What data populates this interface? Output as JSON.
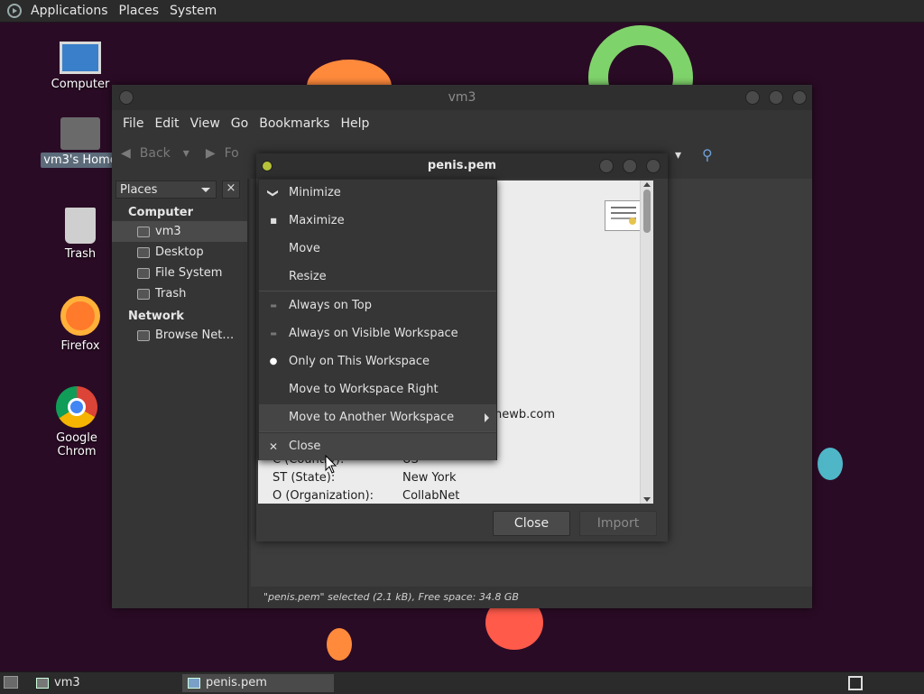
{
  "top_panel": {
    "menus": [
      "Applications",
      "Places",
      "System"
    ]
  },
  "desktop": {
    "icons": [
      {
        "label": "Computer"
      },
      {
        "label": "vm3's Home"
      },
      {
        "label": "Trash"
      },
      {
        "label": "Firefox"
      },
      {
        "label": "Google Chrom"
      }
    ]
  },
  "file_manager": {
    "title": "vm3",
    "menus": [
      "File",
      "Edit",
      "View",
      "Go",
      "Bookmarks",
      "Help"
    ],
    "toolbar": {
      "back": "Back",
      "forward": "Fo"
    },
    "sidebar": {
      "selector": "Places",
      "close": "×",
      "sections": [
        {
          "heading": "Computer",
          "items": [
            "vm3",
            "Desktop",
            "File System",
            "Trash"
          ]
        },
        {
          "heading": "Network",
          "items": [
            "Browse Net…"
          ]
        }
      ]
    },
    "status": "\"penis.pem\" selected (2.1 kB), Free space: 34.8 GB"
  },
  "dialog": {
    "title": "penis.pem",
    "partial_text": "newb.com",
    "fields": [
      {
        "label": "C (Country):",
        "value": "US"
      },
      {
        "label": "ST (State):",
        "value": "New York"
      },
      {
        "label": "O (Organization):",
        "value": "CollabNet"
      }
    ],
    "buttons": {
      "close": "Close",
      "import": "Import"
    }
  },
  "context_menu": {
    "items": [
      {
        "label": "Minimize",
        "mark": "❯"
      },
      {
        "label": "Maximize",
        "mark": "■"
      },
      {
        "label": "Move",
        "mark": ""
      },
      {
        "label": "Resize",
        "mark": ""
      },
      {
        "label": "Always on Top",
        "mark": "▬"
      },
      {
        "label": "Always on Visible Workspace",
        "mark": "▬"
      },
      {
        "label": "Only on This Workspace",
        "mark": "●"
      },
      {
        "label": "Move to Workspace Right",
        "mark": ""
      },
      {
        "label": "Move to Another Workspace",
        "mark": ""
      },
      {
        "label": "Close",
        "mark": "✕"
      }
    ]
  },
  "taskbar": {
    "tasks": [
      "vm3",
      "penis.pem"
    ]
  },
  "colors": {
    "wallpaper": "#2a0b25",
    "panel": "#2b2b2b",
    "dialog_body": "#ececec"
  }
}
